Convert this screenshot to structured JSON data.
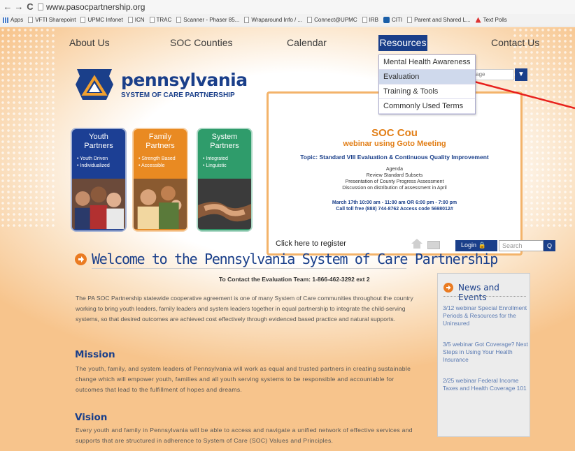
{
  "browser": {
    "url": "www.pasocpartnership.org",
    "back": "←",
    "forward": "→",
    "reload": "C",
    "bookmarks": [
      "Apps",
      "VFTI Sharepoint",
      "UPMC Infonet",
      "ICN",
      "TRAC",
      "Scanner - Phaser 85...",
      "Wraparound Info / ...",
      "Connect@UPMC",
      "IRB",
      "CITI",
      "Parent and Shared L...",
      "Text Polls"
    ]
  },
  "nav": {
    "about": "About Us",
    "counties": "SOC Counties",
    "calendar": "Calendar",
    "resources": "Resources",
    "contact": "Contact Us",
    "dropdown": [
      "Mental Health Awareness",
      "Evaluation",
      "Training & Tools",
      "Commonly Used Terms"
    ]
  },
  "logo": {
    "title": "pennsylvania",
    "subtitle": "SYSTEM OF CARE PARTNERSHIP"
  },
  "language": {
    "label": "ect Language",
    "arrow": "▼"
  },
  "tiles": [
    {
      "title1": "Youth",
      "title2": "Partners",
      "b1": "Youth Driven",
      "b2": "Individualized",
      "color": "#1c3f94"
    },
    {
      "title1": "Family",
      "title2": "Partners",
      "b1": "Strength Based",
      "b2": "Accessible",
      "color": "#e98a22"
    },
    {
      "title1": "System",
      "title2": "Partners",
      "b1": "Integrated",
      "b2": "Linguistic",
      "color": "#2f9c6b"
    }
  ],
  "slider": {
    "title": "SOC Cou",
    "subtitle": "webinar using Goto Meeting",
    "topic": "Topic: Standard VIII Evaluation & Continuous Quality Improvement",
    "agenda": "Agenda",
    "l1": "Review Standard Subsets",
    "l2": "Presentation of County Progress Assessment",
    "l3": "Discussion on distribution of assessment in April",
    "date": "March 17th  10:00 am - 11:00 am  OR  6:00 pm - 7:00 pm",
    "call": "Call toll free (888) 744-8762 Access code  5698012#",
    "register": "Click here to register"
  },
  "utility": {
    "login": "Login",
    "search_placeholder": "Search",
    "search_btn": "Q"
  },
  "welcome": "Welcome to the Pennsylvania System of Care Partnership",
  "contact_line": "To Contact the Evaluation Team: 1-866-462-3292  ext 2",
  "intro": "The PA SOC Partnership statewide cooperative agreement is one of many System of Care communities throughout the country working to bring youth leaders, family leaders and system leaders together in equal partnership to integrate the child-serving systems, so that desired outcomes are achieved cost effectively through evidenced based practice and natural supports.",
  "mission_heading": "Mission",
  "mission": "The youth, family, and system leaders of Pennsylvania will work as equal and trusted partners in creating sustainable change which will empower youth, families and all youth serving systems to be responsible and accountable for outcomes that lead to the fulfillment of hopes and dreams.",
  "vision_heading": "Vision",
  "vision": "Every youth and family in Pennsylvania will be able to access and navigate a unified network of effective services and supports that are structured in adherence to System of Care (SOC) Values and Principles.",
  "news": {
    "title": "News and Events",
    "items": [
      "3/12 webinar Special Enrollment Periods & Resources for the Uninsured",
      "3/5 webinar Got Coverage? Next Steps in Using Your Health Insurance",
      "2/25 webinar Federal Income Taxes and Health Coverage 101"
    ]
  },
  "colors": {
    "brand": "#1a3f8a",
    "accent": "#ea7b22",
    "annotation": "#e8201c"
  }
}
